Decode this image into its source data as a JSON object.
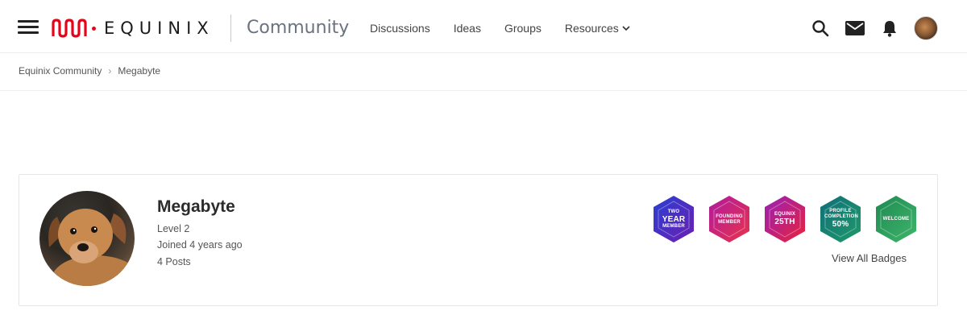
{
  "header": {
    "logo_text": "EQUINIX",
    "community_title": "Community",
    "nav": [
      {
        "label": "Discussions"
      },
      {
        "label": "Ideas"
      },
      {
        "label": "Groups"
      },
      {
        "label": "Resources"
      }
    ],
    "icons": [
      "menu-icon",
      "search-icon",
      "mail-icon",
      "bell-icon",
      "user-avatar"
    ],
    "brand_color": "#e3051b"
  },
  "breadcrumb": {
    "items": [
      "Equinix Community",
      "Megabyte"
    ],
    "separator": "›"
  },
  "profile": {
    "name": "Megabyte",
    "level": "Level 2",
    "joined": "Joined 4 years ago",
    "posts": "4 Posts",
    "badges": [
      {
        "line1": "TWO",
        "line2": "YEAR",
        "line3": "MEMBER",
        "colors": [
          "#2a3fd4",
          "#6b1fb0"
        ]
      },
      {
        "line1": "FOUNDING",
        "line2": "",
        "line3": "MEMBER",
        "colors": [
          "#b01a9e",
          "#e8334a"
        ]
      },
      {
        "line1": "EQUINIX",
        "line2": "25TH",
        "line3": "",
        "colors": [
          "#9a1fb8",
          "#e8233a"
        ]
      },
      {
        "line1": "PROFILE",
        "line2": "50%",
        "line3": "COMPLETION",
        "colors": [
          "#0f6e78",
          "#1f9a6a"
        ]
      },
      {
        "line1": "WELCOME",
        "line2": "",
        "line3": "",
        "colors": [
          "#1e8a52",
          "#3fb56a"
        ]
      }
    ],
    "view_all_badges": "View All Badges"
  }
}
